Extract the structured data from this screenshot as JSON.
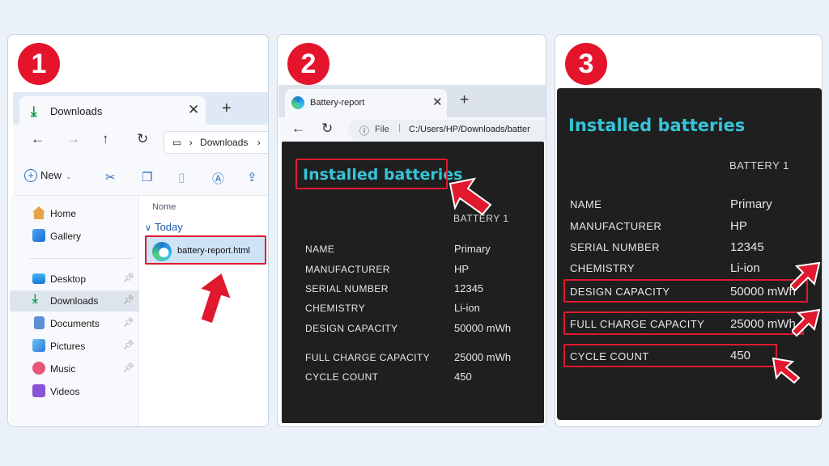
{
  "steps": [
    "1",
    "2",
    "3"
  ],
  "explorer": {
    "tab_title": "Downloads",
    "tab_close": "✕",
    "new_tab": "+",
    "address": "Downloads",
    "new_label": "New",
    "sidebar": {
      "home": "Home",
      "gallery": "Gallery",
      "desktop": "Desktop",
      "downloads": "Downloads",
      "documents": "Documents",
      "pictures": "Pictures",
      "music": "Music",
      "videos": "Videos"
    },
    "column_header": "Nome",
    "group_label": "Today",
    "file_name": "battery-report.html"
  },
  "browser": {
    "tab_title": "Battery-report",
    "tab_close": "✕",
    "new_tab": "+",
    "address_scheme": "File",
    "address_url": "C:/Users/HP/Downloads/batter"
  },
  "report": {
    "title": "Installed batteries",
    "column": "BATTERY 1",
    "rows": [
      {
        "label": "NAME",
        "value": "Primary"
      },
      {
        "label": "MANUFACTURER",
        "value": "HP"
      },
      {
        "label": "SERIAL NUMBER",
        "value": "12345"
      },
      {
        "label": "CHEMISTRY",
        "value": "Li-ion"
      },
      {
        "label": "DESIGN CAPACITY",
        "value": "50000 mWh"
      },
      {
        "label": "FULL CHARGE CAPACITY",
        "value": "25000 mWh"
      },
      {
        "label": "CYCLE COUNT",
        "value": "450"
      }
    ]
  },
  "colors": {
    "accent_red": "#e0192f",
    "report_bg": "#1f1f1f",
    "report_title": "#35c4d8",
    "page_bg": "#eaf1f9"
  },
  "icons": [
    "download-icon",
    "close-icon",
    "plus-icon",
    "back-arrow-icon",
    "forward-arrow-icon",
    "up-arrow-icon",
    "refresh-icon",
    "monitor-icon",
    "chevron-right-icon",
    "cut-icon",
    "copy-icon",
    "paste-icon",
    "rename-icon",
    "share-icon",
    "home-icon",
    "gallery-icon",
    "desktop-icon",
    "downloads-icon",
    "documents-icon",
    "pictures-icon",
    "music-icon",
    "videos-icon",
    "pin-icon",
    "edge-icon",
    "info-icon",
    "pointer-arrow-icon"
  ]
}
